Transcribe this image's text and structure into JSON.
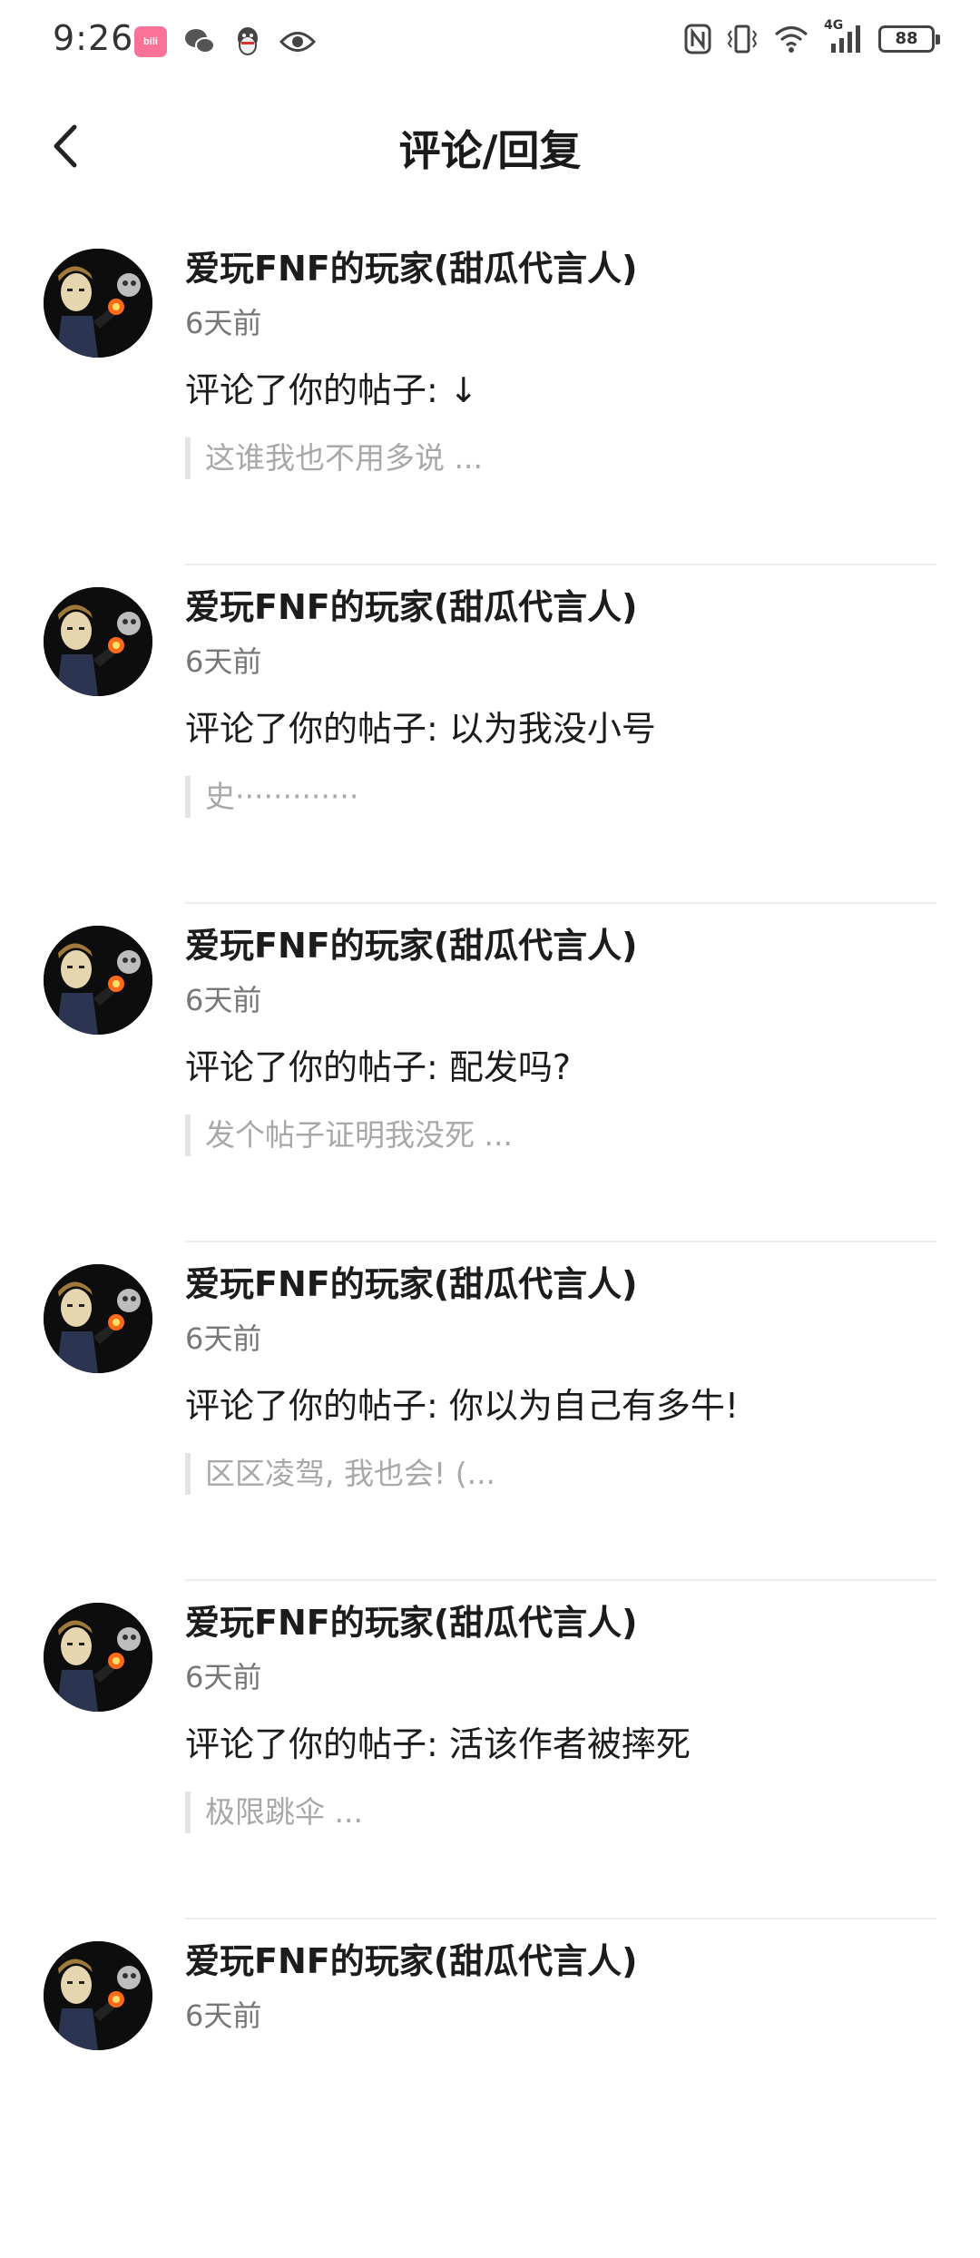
{
  "status_bar": {
    "time": "9:26",
    "left_icons": [
      "bilibili-icon",
      "wechat-icon",
      "qq-icon",
      "eye-icon"
    ],
    "right_icons": [
      "nfc-icon",
      "vibrate-icon",
      "wifi-icon",
      "signal-4g-icon"
    ],
    "network_label": "4G",
    "battery": "88"
  },
  "header": {
    "title": "评论/回复"
  },
  "notifications": [
    {
      "user": "爱玩FNF的玩家(甜瓜代言人)",
      "time": "6天前",
      "action": "评论了你的帖子: ↓",
      "quote": "这谁我也不用多说 ..."
    },
    {
      "user": "爱玩FNF的玩家(甜瓜代言人)",
      "time": "6天前",
      "action": "评论了你的帖子: 以为我没小号",
      "quote": "史·············"
    },
    {
      "user": "爱玩FNF的玩家(甜瓜代言人)",
      "time": "6天前",
      "action": "评论了你的帖子: 配发吗?",
      "quote": "发个帖子证明我没死 ..."
    },
    {
      "user": "爱玩FNF的玩家(甜瓜代言人)",
      "time": "6天前",
      "action": "评论了你的帖子: 你以为自己有多牛!",
      "quote": "区区凌驾, 我也会! (..."
    },
    {
      "user": "爱玩FNF的玩家(甜瓜代言人)",
      "time": "6天前",
      "action": "评论了你的帖子: 活该作者被摔死",
      "quote": "极限跳伞      ..."
    },
    {
      "user": "爱玩FNF的玩家(甜瓜代言人)",
      "time": "6天前",
      "action": "",
      "quote": ""
    }
  ]
}
